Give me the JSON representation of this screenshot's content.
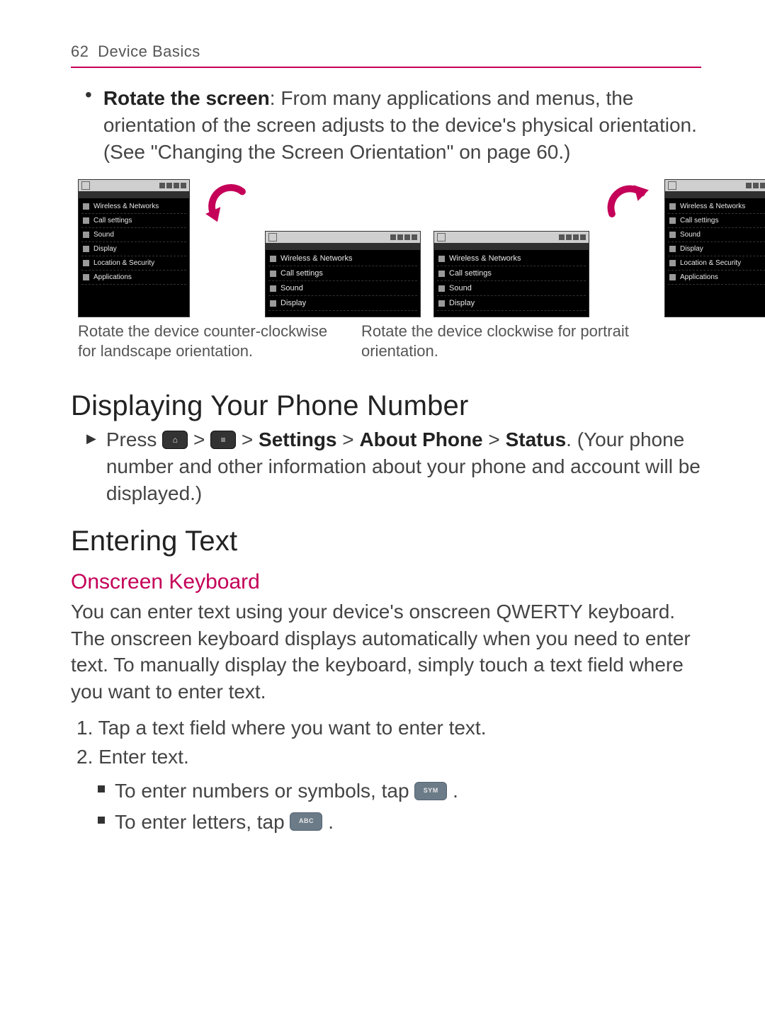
{
  "header": {
    "page_number": "62",
    "section": "Device Basics"
  },
  "rotate_bullet": {
    "label": "Rotate the screen",
    "text": ": From many applications and menus, the orientation of the screen adjusts to the device's physical orientation. (See \"Changing the Screen Orientation\" on page 60.)"
  },
  "settings_menu": {
    "items": [
      "Wireless & Networks",
      "Call settings",
      "Sound",
      "Display",
      "Location & Security",
      "Applications"
    ],
    "landscape_items": [
      "Wireless & Networks",
      "Call settings",
      "Sound",
      "Display"
    ]
  },
  "captions": {
    "left": "Rotate the device counter-clockwise for landscape orientation.",
    "right": "Rotate the device clockwise for portrait orientation."
  },
  "section_phone": {
    "title": "Displaying Your Phone Number",
    "press": "Press",
    "path_parts": {
      "gt": " > ",
      "settings": "Settings",
      "about": "About Phone",
      "status": "Status"
    },
    "tail": ". (Your phone number and other information about your phone and account will be displayed.)"
  },
  "section_text": {
    "title": "Entering Text"
  },
  "onscreen": {
    "title": "Onscreen Keyboard",
    "para": "You can enter text using your device's onscreen QWERTY keyboard. The onscreen keyboard displays automatically when you need to enter text. To manually display the keyboard, simply touch a text field where you want to enter text.",
    "step1": "1. Tap a text field where you want to enter text.",
    "step2": "2. Enter text.",
    "sub_a_pre": "To enter numbers or symbols, tap ",
    "sub_a_key": "SYM",
    "sub_b_pre": "To enter letters, tap ",
    "sub_b_key": "ABC",
    "dot": "."
  },
  "icons": {
    "home": "⌂",
    "menu": "≡"
  }
}
